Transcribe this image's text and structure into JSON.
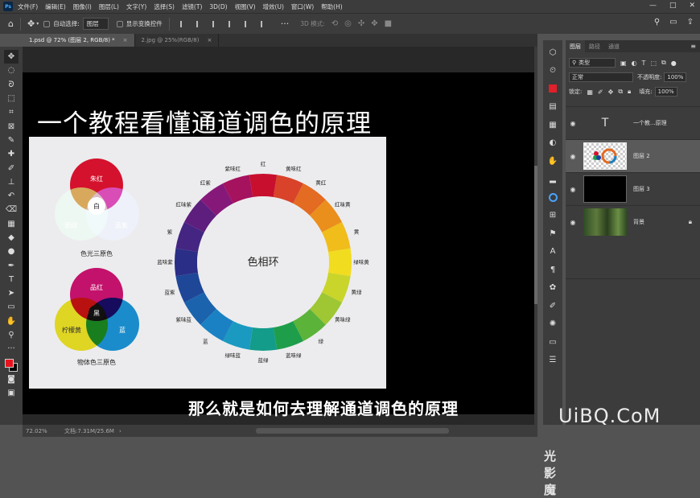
{
  "app": {
    "logo": "Ps"
  },
  "menu": [
    "文件(F)",
    "编辑(E)",
    "图像(I)",
    "图层(L)",
    "文字(Y)",
    "选择(S)",
    "滤镜(T)",
    "3D(D)",
    "视图(V)",
    "增效(U)",
    "窗口(W)",
    "帮助(H)"
  ],
  "window_controls": [
    "—",
    "□",
    "✕"
  ],
  "options": {
    "auto_select_label": "自动选择:",
    "auto_select_value": "图层",
    "show_transform_label": "显示变换控件",
    "mode_3d_label": "3D 模式:"
  },
  "tabs": [
    {
      "label": "1.psd @ 72% (图层 2, RGB/8) *",
      "close": "×"
    },
    {
      "label": "2.jpg @ 25%(RGB/8)",
      "close": "×"
    }
  ],
  "canvas": {
    "headline": "一个教程看懂通道调色的原理",
    "caption": "那么就是如何去理解通道调色的原理",
    "watermark_left": "光影魔",
    "watermark_right": "UiBQ.CoM"
  },
  "diagram": {
    "light_circles": {
      "red": "朱红",
      "green": "翠绿",
      "blue": "蓝紫",
      "center": "白",
      "label": "色光三原色"
    },
    "pigment_circles": {
      "magenta": "品红",
      "yellow": "柠檬黄",
      "cyan": "蓝",
      "center": "黑",
      "label": "物体色三原色"
    },
    "wheel_title": "色相环",
    "wheel_labels": [
      "红",
      "黄味红",
      "黄红",
      "红味黄",
      "黄",
      "绿味黄",
      "黄绿",
      "黄味绿",
      "绿",
      "蓝味绿",
      "蓝绿",
      "绿味蓝",
      "蓝",
      "紫味蓝",
      "蓝紫",
      "蓝味紫",
      "紫",
      "红味紫",
      "红紫",
      "紫味红"
    ],
    "wheel_colors": [
      "#c8102e",
      "#d8432a",
      "#e36b22",
      "#ea8f1c",
      "#f0bd1a",
      "#f2dc1f",
      "#c9d52a",
      "#9ec733",
      "#5bb33a",
      "#1e9e4a",
      "#139c8a",
      "#1a9ac0",
      "#1a82c4",
      "#1b63ad",
      "#1f4797",
      "#2a2e86",
      "#442582",
      "#5e1e7e",
      "#86187a",
      "#a5125e"
    ]
  },
  "status": {
    "zoom": "72.02%",
    "doc": "文档:7.31M/25.6M",
    "arrow": "›"
  },
  "panel": {
    "tabs": [
      "图层",
      "路径",
      "通道"
    ],
    "menu_icon": "≡",
    "filter_kind": "类型",
    "blend_mode": "正常",
    "opacity_label": "不透明度:",
    "opacity_value": "100%",
    "lock_label": "锁定:",
    "fill_label": "填充:",
    "fill_value": "100%",
    "layers": [
      {
        "name": "一个教...原理",
        "type": "text",
        "thumb": "T"
      },
      {
        "name": "图层 2",
        "type": "image"
      },
      {
        "name": "图层 3",
        "type": "black"
      },
      {
        "name": "背景",
        "type": "forest",
        "locked": true
      }
    ]
  }
}
